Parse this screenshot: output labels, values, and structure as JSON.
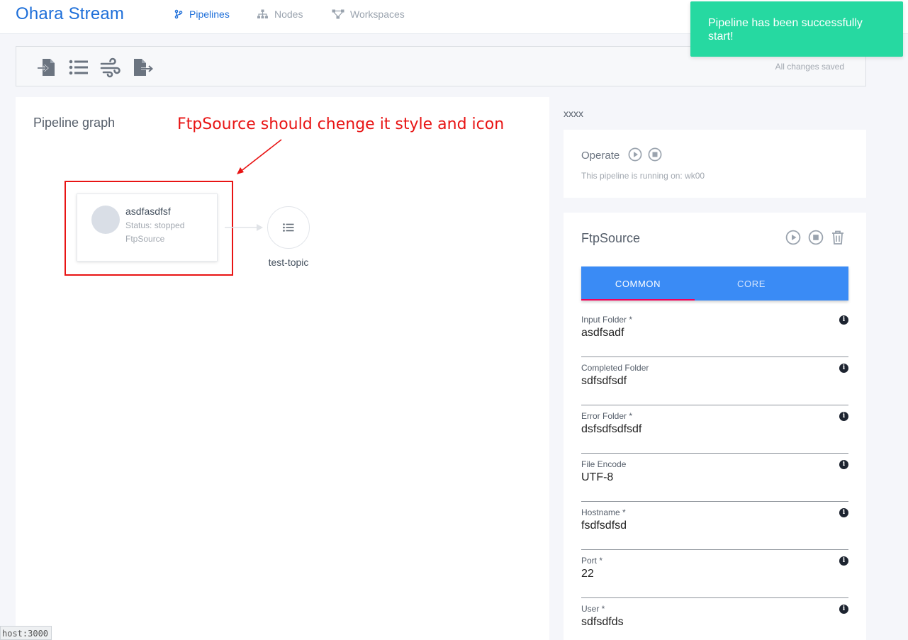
{
  "header": {
    "brand": "Ohara Stream",
    "nav": [
      {
        "label": "Pipelines",
        "icon": "branch-icon",
        "active": true
      },
      {
        "label": "Nodes",
        "icon": "sitemap-icon",
        "active": false
      },
      {
        "label": "Workspaces",
        "icon": "network-icon",
        "active": false
      }
    ]
  },
  "toast": {
    "message": "Pipeline has been successfully start!",
    "color": "#26d9a1"
  },
  "toolbar": {
    "tools": [
      "source-connector-icon",
      "topic-list-icon",
      "stream-app-icon",
      "sink-connector-icon"
    ],
    "saved_status": "All changes saved"
  },
  "graph": {
    "title": "Pipeline graph",
    "annotation": "FtpSource should chenge it style and icon",
    "annotation_color": "#e81414",
    "node": {
      "name": "asdfasdfsf",
      "status": "Status: stopped",
      "type": "FtpSource"
    },
    "topic": {
      "label": "test-topic"
    }
  },
  "pipeline": {
    "name": "xxxx"
  },
  "operate": {
    "label": "Operate",
    "running_on": "This pipeline is running on: wk00"
  },
  "connector": {
    "title": "FtpSource",
    "tabs": [
      {
        "label": "COMMON",
        "active": true
      },
      {
        "label": "CORE",
        "active": false
      }
    ],
    "fields": [
      {
        "label": "Input Folder *",
        "value": "asdfsadf"
      },
      {
        "label": "Completed Folder",
        "value": "sdfsdfsdf"
      },
      {
        "label": "Error Folder *",
        "value": "dsfsdfsdfsdf"
      },
      {
        "label": "File Encode",
        "value": "UTF-8"
      },
      {
        "label": "Hostname *",
        "value": "fsdfsdfsd"
      },
      {
        "label": "Port *",
        "value": "22"
      },
      {
        "label": "User *",
        "value": "sdfsdfds"
      }
    ]
  },
  "status_bar": {
    "url_fragment": "host:3000"
  },
  "colors": {
    "primary": "#1e6fd9",
    "tab_bar": "#3a8bf5",
    "tab_indicator": "#f5005a"
  }
}
